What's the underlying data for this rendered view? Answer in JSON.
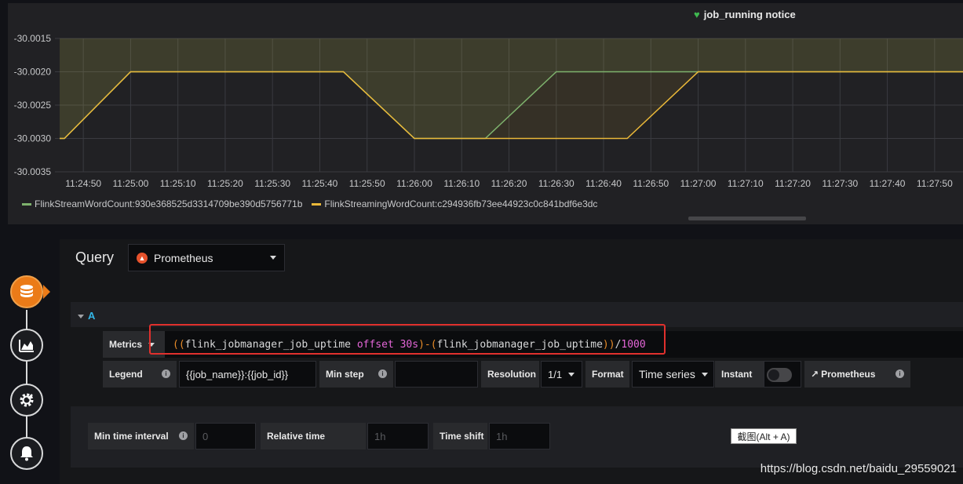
{
  "graph": {
    "title": "job_running notice",
    "heart_icon": "heart-icon",
    "legend": [
      {
        "name": "FlinkStreamWordCount:930e368525d3314709be390d5756771b",
        "color": "#7eb26d"
      },
      {
        "name": "FlinkStreamingWordCount:c294936fb73ee44923c0c841bdf6e3dc",
        "color": "#eab839"
      }
    ]
  },
  "chart_data": {
    "type": "line",
    "y_ticks": [
      "-30.0015",
      "-30.0020",
      "-30.0025",
      "-30.0030",
      "-30.0035"
    ],
    "ylim": [
      -30.0035,
      -30.0015
    ],
    "x_ticks": [
      "11:24:50",
      "11:25:00",
      "11:25:10",
      "11:25:20",
      "11:25:30",
      "11:25:40",
      "11:25:50",
      "11:26:00",
      "11:26:10",
      "11:26:20",
      "11:26:30",
      "11:26:40",
      "11:26:50",
      "11:27:00",
      "11:27:10",
      "11:27:20",
      "11:27:30",
      "11:27:40",
      "11:27:50"
    ],
    "xlim": [
      "11:24:44",
      "11:27:56"
    ],
    "grid": true,
    "legend_position": "bottom-left",
    "series": [
      {
        "name": "FlinkStreamWordCount:930e368525d3314709be390d5756771b",
        "color": "#7eb26d",
        "x": [
          "11:24:45",
          "11:24:46",
          "11:25:00",
          "11:25:45",
          "11:26:00",
          "11:26:15",
          "11:26:30",
          "11:27:00",
          "11:27:56"
        ],
        "values": [
          -30.003,
          -30.003,
          -30.002,
          -30.002,
          -30.003,
          -30.003,
          -30.002,
          -30.002,
          -30.002
        ]
      },
      {
        "name": "FlinkStreamingWordCount:c294936fb73ee44923c0c841bdf6e3dc",
        "color": "#eab839",
        "x": [
          "11:24:45",
          "11:24:46",
          "11:25:00",
          "11:25:45",
          "11:26:00",
          "11:26:45",
          "11:27:00",
          "11:27:56"
        ],
        "values": [
          -30.003,
          -30.003,
          -30.002,
          -30.002,
          -30.003,
          -30.003,
          -30.002,
          -30.002
        ]
      }
    ]
  },
  "rail": {
    "items": [
      {
        "name": "database-icon",
        "active": true
      },
      {
        "name": "chart-icon",
        "active": false
      },
      {
        "name": "gear-icon",
        "active": false
      },
      {
        "name": "bell-icon",
        "active": false
      }
    ]
  },
  "query": {
    "title": "Query",
    "datasource": "Prometheus",
    "ds_icon": "prometheus-icon",
    "ref_id": "A",
    "metrics_label": "Metrics",
    "expr_parts": [
      {
        "t": "((",
        "c": "paren"
      },
      {
        "t": "flink_jobmanager_job_uptime ",
        "c": "plain"
      },
      {
        "t": "offset",
        "c": "kw"
      },
      {
        "t": " 30s",
        "c": "kw"
      },
      {
        "t": ")-(",
        "c": "paren"
      },
      {
        "t": "flink_jobmanager_job_uptime",
        "c": "plain"
      },
      {
        "t": "))",
        "c": "paren"
      },
      {
        "t": "/",
        "c": "plain"
      },
      {
        "t": "1000",
        "c": "num"
      }
    ],
    "legend_label": "Legend",
    "legend_value": "{{job_name}}:{{job_id}}",
    "min_step_label": "Min step",
    "min_step_value": "",
    "resolution_label": "Resolution",
    "resolution_value": "1/1",
    "format_label": "Format",
    "format_value": "Time series",
    "instant_label": "Instant",
    "instant_on": false,
    "prom_link_label": "Prometheus",
    "link_icon": "external-link-icon"
  },
  "options": {
    "min_interval_label": "Min time interval",
    "min_interval_placeholder": "0",
    "relative_time_label": "Relative time",
    "relative_time_placeholder": "1h",
    "time_shift_label": "Time shift",
    "time_shift_placeholder": "1h"
  },
  "overlay": {
    "tooltip": "截图(Alt + A)",
    "watermark": "https://blog.csdn.net/baidu_29559021"
  }
}
